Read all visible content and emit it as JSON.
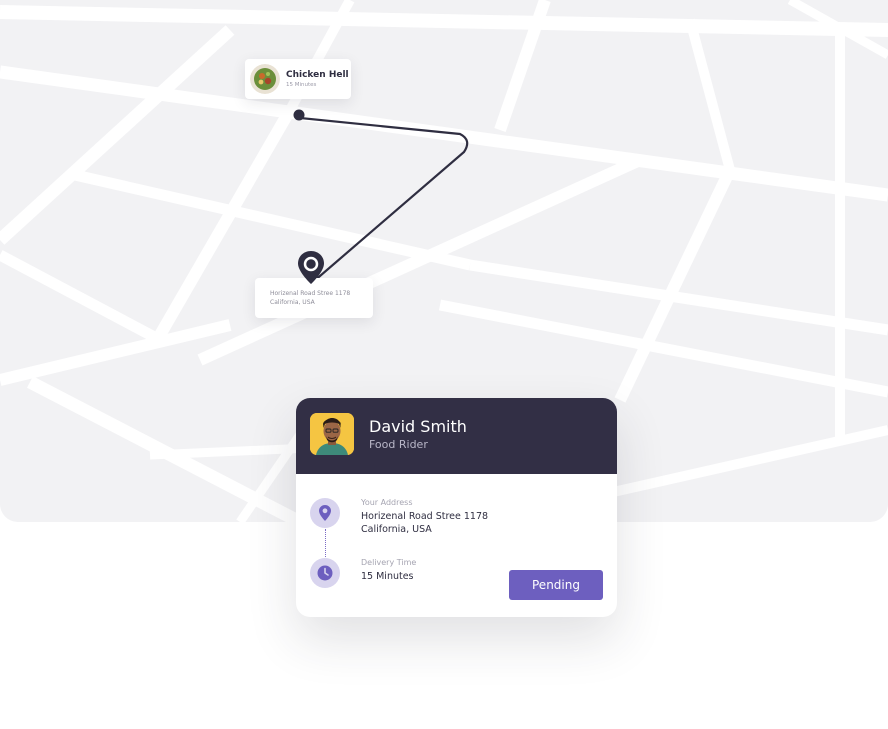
{
  "colors": {
    "map_background": "#f2f2f4",
    "road": "#ffffff",
    "route": "#2f2e41",
    "card_header": "#322f45",
    "accent": "#6d5fbf",
    "icon_background": "#d8d4ee",
    "avatar_background": "#f5c542"
  },
  "restaurant": {
    "name": "Chicken Hell",
    "time": "15 Minutes",
    "icon": "food-bowl-image"
  },
  "destination": {
    "line1": "Horizenal Road Stree 1178",
    "line2": "California, USA",
    "icon": "map-pin-icon"
  },
  "rider": {
    "name": "David Smith",
    "role": "Food Rider",
    "address_label": "Your Address",
    "address_line1": "Horizenal Road Stree 1178",
    "address_line2": "California, USA",
    "time_label": "Delivery Time",
    "time_value": "15 Minutes",
    "status_button": "Pending",
    "icons": [
      "location-icon",
      "clock-icon"
    ]
  }
}
